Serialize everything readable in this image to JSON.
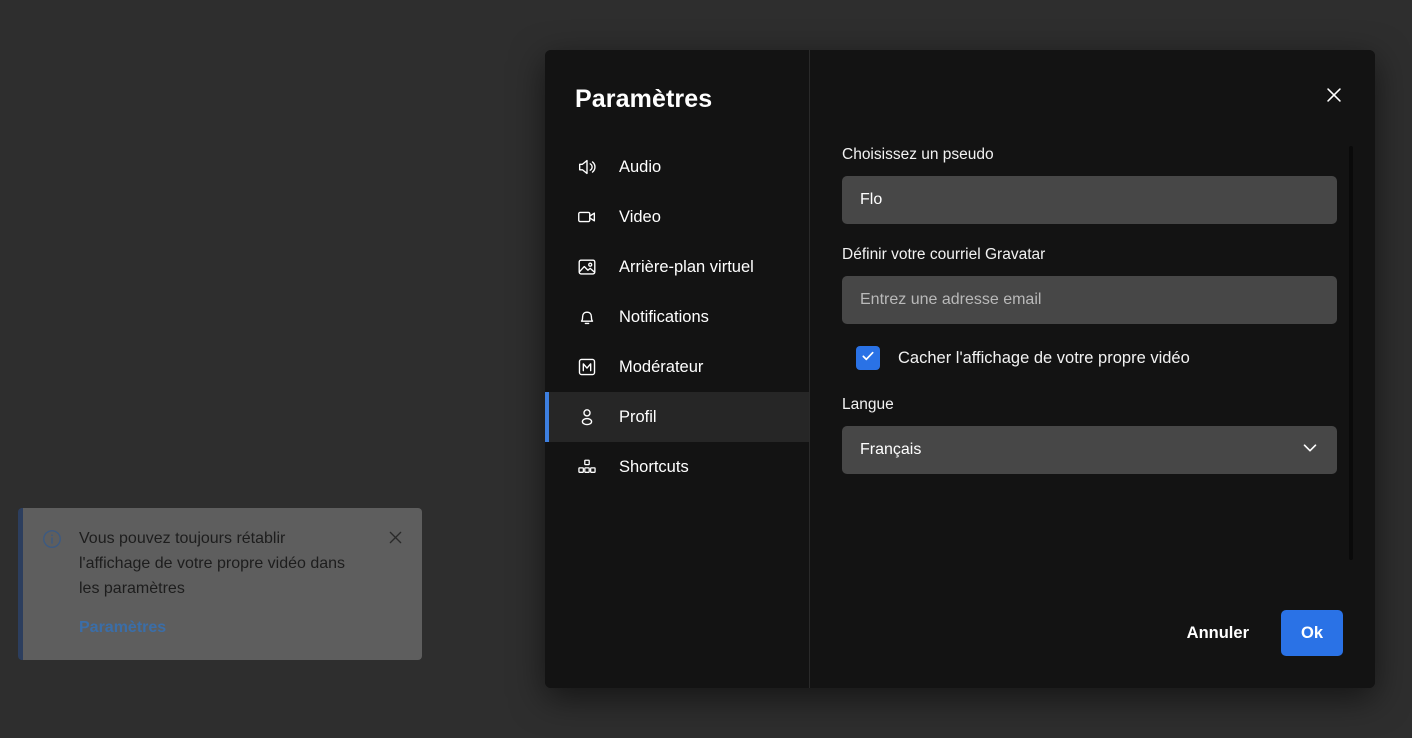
{
  "dialog": {
    "title": "Paramètres",
    "close_icon": "close-icon"
  },
  "sidebar": {
    "items": [
      {
        "label": "Audio",
        "icon": "speaker-icon",
        "active": false
      },
      {
        "label": "Video",
        "icon": "video-camera-icon",
        "active": false
      },
      {
        "label": "Arrière-plan virtuel",
        "icon": "image-icon",
        "active": false
      },
      {
        "label": "Notifications",
        "icon": "bell-icon",
        "active": false
      },
      {
        "label": "Modérateur",
        "icon": "moderator-m-icon",
        "active": false
      },
      {
        "label": "Profil",
        "icon": "person-icon",
        "active": true
      },
      {
        "label": "Shortcuts",
        "icon": "shortcuts-grid-icon",
        "active": false
      }
    ]
  },
  "profile": {
    "nickname_label": "Choisissez un pseudo",
    "nickname_value": "Flo",
    "nickname_placeholder": "",
    "gravatar_label": "Définir votre courriel Gravatar",
    "gravatar_value": "",
    "gravatar_placeholder": "Entrez une adresse email",
    "hide_self_view_label": "Cacher l'affichage de votre propre vidéo",
    "hide_self_view_checked": true,
    "language_label": "Langue",
    "language_value": "Français"
  },
  "footer": {
    "cancel_label": "Annuler",
    "ok_label": "Ok"
  },
  "toast": {
    "message": "Vous pouvez toujours rétablir l'affichage de votre propre vidéo dans les paramètres",
    "link_label": "Paramètres",
    "info_icon": "info-circle-icon",
    "close_icon": "close-icon"
  },
  "colors": {
    "accent": "#2a72e6",
    "active_bar": "#3d7fe0",
    "dialog_bg": "#131313",
    "input_bg": "#474747",
    "backdrop": "#2e2e2e",
    "toast_bg": "#5e5e5e",
    "toast_border": "#2c3e5e",
    "toast_link": "#3b6ea8"
  }
}
